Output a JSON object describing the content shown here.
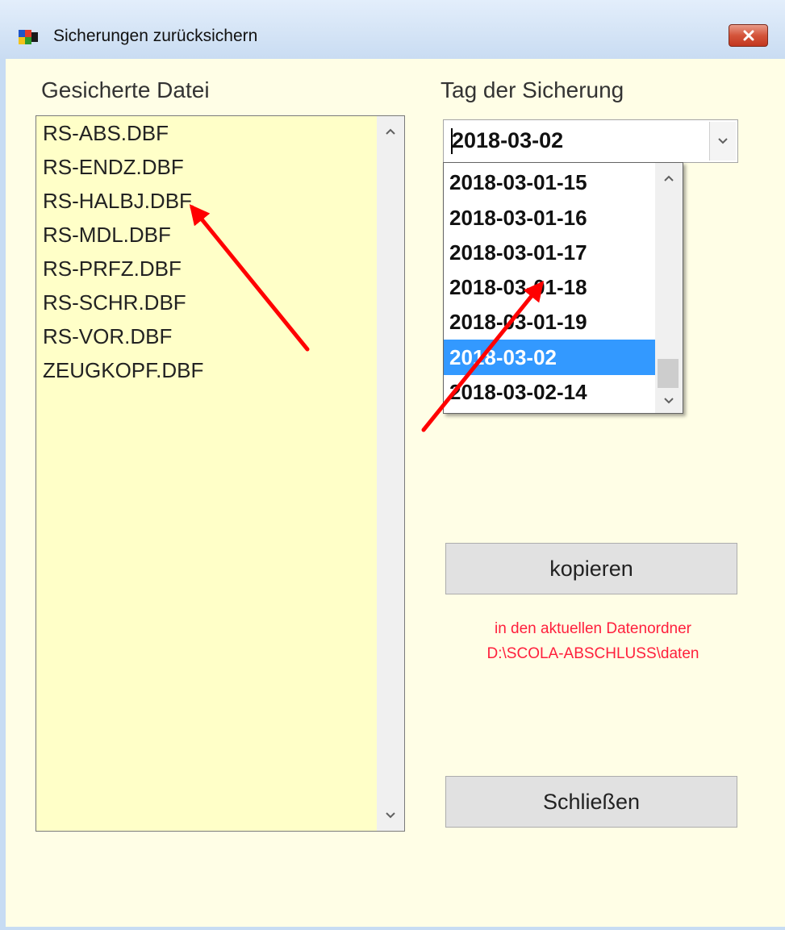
{
  "window": {
    "title": "Sicherungen zurücksichern",
    "title_icon": "app-icon",
    "close_icon": "close-icon"
  },
  "left": {
    "label": "Gesicherte Datei",
    "files": [
      "RS-ABS.DBF",
      "RS-ENDZ.DBF",
      "RS-HALBJ.DBF",
      "RS-MDL.DBF",
      "RS-PRFZ.DBF",
      "RS-SCHR.DBF",
      "RS-VOR.DBF",
      "ZEUGKOPF.DBF"
    ]
  },
  "right": {
    "label": "Tag der Sicherung",
    "selected_value": "2018-03-02",
    "dropdown_options": [
      "2018-03-01-15",
      "2018-03-01-16",
      "2018-03-01-17",
      "2018-03-01-18",
      "2018-03-01-19",
      "2018-03-02",
      "2018-03-02-14"
    ],
    "highlighted_option": "2018-03-02"
  },
  "actions": {
    "copy_label": "kopieren",
    "note_line1": "in den aktuellen Datenordner",
    "note_line2": "D:\\SCOLA-ABSCHLUSS\\daten",
    "close_label": "Schließen"
  },
  "colors": {
    "list_background": "#ffffc8",
    "window_background": "#fffee6",
    "selection": "#3399ff",
    "note_text": "#ff1f3c",
    "annotation_arrow": "#ff0000"
  }
}
